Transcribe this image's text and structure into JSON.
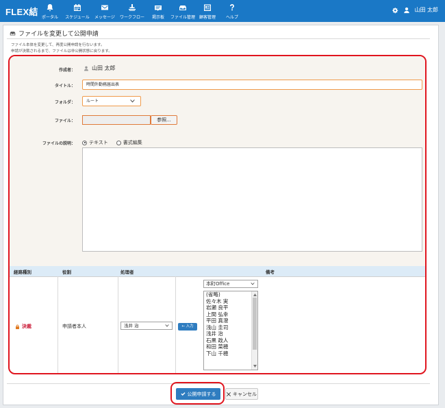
{
  "app": {
    "brand": "FLEX結"
  },
  "nav": [
    {
      "label": "ポータル",
      "icon": "bell-icon"
    },
    {
      "label": "スケジュール",
      "icon": "calendar-icon"
    },
    {
      "label": "メッセージ",
      "icon": "mail-icon"
    },
    {
      "label": "ワークフロー",
      "icon": "workflow-icon"
    },
    {
      "label": "掲示板",
      "icon": "board-icon"
    },
    {
      "label": "ファイル管理",
      "icon": "folder-icon"
    },
    {
      "label": "顧客管理",
      "icon": "customer-icon"
    },
    {
      "label": "ヘルプ",
      "icon": "help-icon"
    }
  ],
  "user": {
    "name": "山田 太郎"
  },
  "page": {
    "title": "ファイルを変更して公開申請",
    "desc1": "ファイル本体を変更して、再度公開申請を行ないます。",
    "desc2": "申請が決裁されるまで、ファイルは非公開状態に戻ります。"
  },
  "form": {
    "author_label": "作成者：",
    "author_name": "山田 太郎",
    "title_label": "タイトル：",
    "title_value": "時間外勤務届出表",
    "folder_label": "フォルダ：",
    "folder_value": "ルート",
    "file_label": "ファイル：",
    "browse_label": "参照...",
    "desc_label": "ファイルの説明：",
    "radio_text": "テキスト",
    "radio_rich": "書式編集"
  },
  "route": {
    "headers": {
      "type": "経路種別",
      "role": "役割",
      "handler": "処理者",
      "note": "備考"
    },
    "type": "決裁",
    "role": "申請者本人",
    "handler": "浅井 治",
    "add_label": "入力",
    "office": "本町Office",
    "candidates": [
      "(省略)",
      "佐々木 実",
      "岩瀬 良平",
      "上間 弘幸",
      "平田 真澄",
      "浅山 圭司",
      "浅井 治",
      "石黒 政人",
      "和田 菜穂",
      "下山 千穂"
    ]
  },
  "actions": {
    "submit": "公開申請する",
    "cancel": "キャンセル"
  },
  "colors": {
    "header": "#1a78c6",
    "button": "#2f7dc0",
    "highlight": "#e0141e",
    "route_type": "#c8102e"
  }
}
